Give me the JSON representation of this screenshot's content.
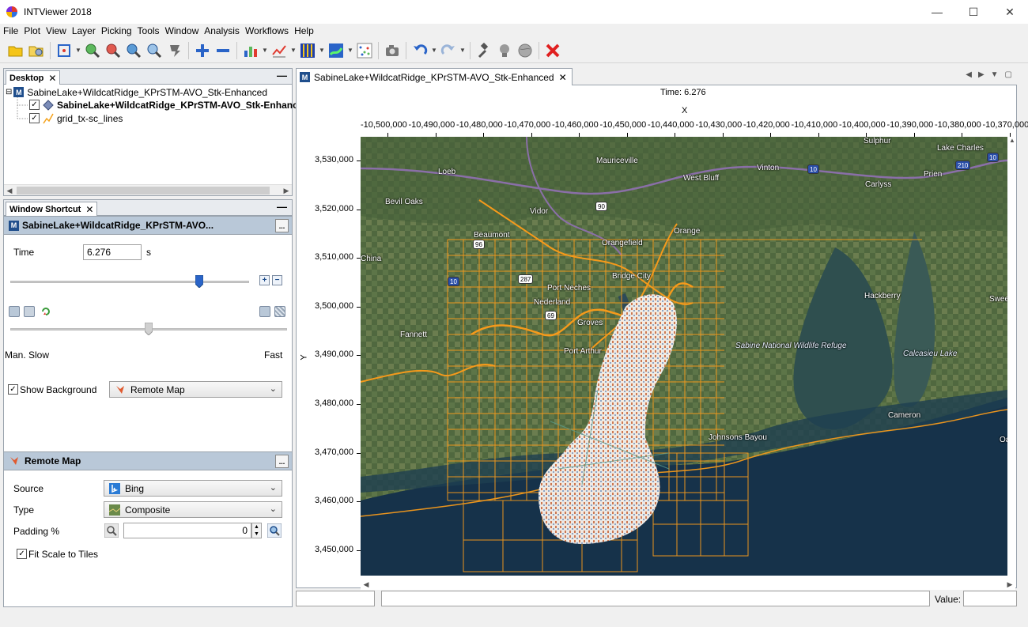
{
  "window": {
    "title": "INTViewer 2018"
  },
  "menu": [
    "File",
    "Plot",
    "View",
    "Layer",
    "Picking",
    "Tools",
    "Window",
    "Analysis",
    "Workflows",
    "Help"
  ],
  "toolbar_icons": [
    "open-folder-icon",
    "open-session-icon",
    "zoom-extent-icon",
    "zoom-in-icon",
    "zoom-out-icon",
    "zoom-box-icon",
    "zoom-magnifier-icon",
    "pan-icon",
    "add-icon",
    "remove-icon",
    "bar-chart-icon",
    "line-chart-icon",
    "seismic-trace-icon",
    "map-layer-icon",
    "scatter-icon",
    "snapshot-icon",
    "undo-icon",
    "redo-icon",
    "tools-icon",
    "lightbulb-icon",
    "globe-icon",
    "close-red-icon"
  ],
  "desktop": {
    "tab_label": "Desktop",
    "tree": {
      "root": "SabineLake+WildcatRidge_KPrSTM-AVO_Stk-Enhanced",
      "children": [
        {
          "label": "SabineLake+WildcatRidge_KPrSTM-AVO_Stk-Enhanced",
          "checked": true,
          "bold": true
        },
        {
          "label": "grid_tx-sc_lines",
          "checked": true,
          "bold": false
        }
      ]
    }
  },
  "shortcut": {
    "tab_label": "Window Shortcut",
    "header": "SabineLake+WildcatRidge_KPrSTM-AVO...",
    "more_label": "...",
    "time_label": "Time",
    "time_value": "6.276",
    "time_unit": "s",
    "time_slider_fraction": 0.79,
    "speed_slider_fraction": 0.5,
    "speed_labels": {
      "manual": "Man.",
      "slow": "Slow",
      "fast": "Fast"
    },
    "show_background_label": "Show Background",
    "show_background_checked": true,
    "background_value": "Remote Map"
  },
  "remote_map": {
    "header": "Remote Map",
    "more_label": "...",
    "source_label": "Source",
    "source_value": "Bing",
    "type_label": "Type",
    "type_value": "Composite",
    "padding_label": "Padding %",
    "padding_value": "0",
    "fit_scale_label": "Fit Scale to Tiles",
    "fit_scale_checked": true
  },
  "document": {
    "tab_label": "SabineLake+WildcatRidge_KPrSTM-AVO_Stk-Enhanced",
    "time_readout": "Time: 6.276",
    "x_axis_label": "X",
    "y_axis_label": "Y",
    "x_ticks": [
      "-10,500,000",
      "-10,490,000",
      "-10,480,000",
      "-10,470,000",
      "-10,460,000",
      "-10,450,000",
      "-10,440,000",
      "-10,430,000",
      "-10,420,000",
      "-10,410,000",
      "-10,400,000",
      "-10,390,000",
      "-10,380,000",
      "-10,370,000"
    ],
    "y_ticks": [
      "3,530,000",
      "3,520,000",
      "3,510,000",
      "3,500,000",
      "3,490,000",
      "3,480,000",
      "3,470,000",
      "3,460,000",
      "3,450,000"
    ],
    "map_labels": [
      "Sulphur",
      "Lake Charles",
      "Loeb",
      "Mauriceville",
      "West Bluff",
      "Vinton",
      "Prien",
      "Carlyss",
      "Bevil Oaks",
      "Vidor",
      "Orange",
      "Beaumont",
      "Orangefield",
      "China",
      "Bridge City",
      "Port Neches",
      "Nederland",
      "Hackberry",
      "Swee",
      "Groves",
      "Fannett",
      "Port Arthur",
      "Sabine National Wildlife Refuge",
      "Calcasieu Lake",
      "Cameron",
      "Johnsons Bayou",
      "Oa"
    ],
    "road_shields": [
      "10",
      "90",
      "96",
      "287",
      "69",
      "10",
      "210",
      "10"
    ]
  },
  "status": {
    "value_label": "Value:",
    "value": ""
  },
  "colors": {
    "accent": "#1f4e8c",
    "section_header": "#b9c8d8",
    "grid_lines": "#f59a1b"
  }
}
